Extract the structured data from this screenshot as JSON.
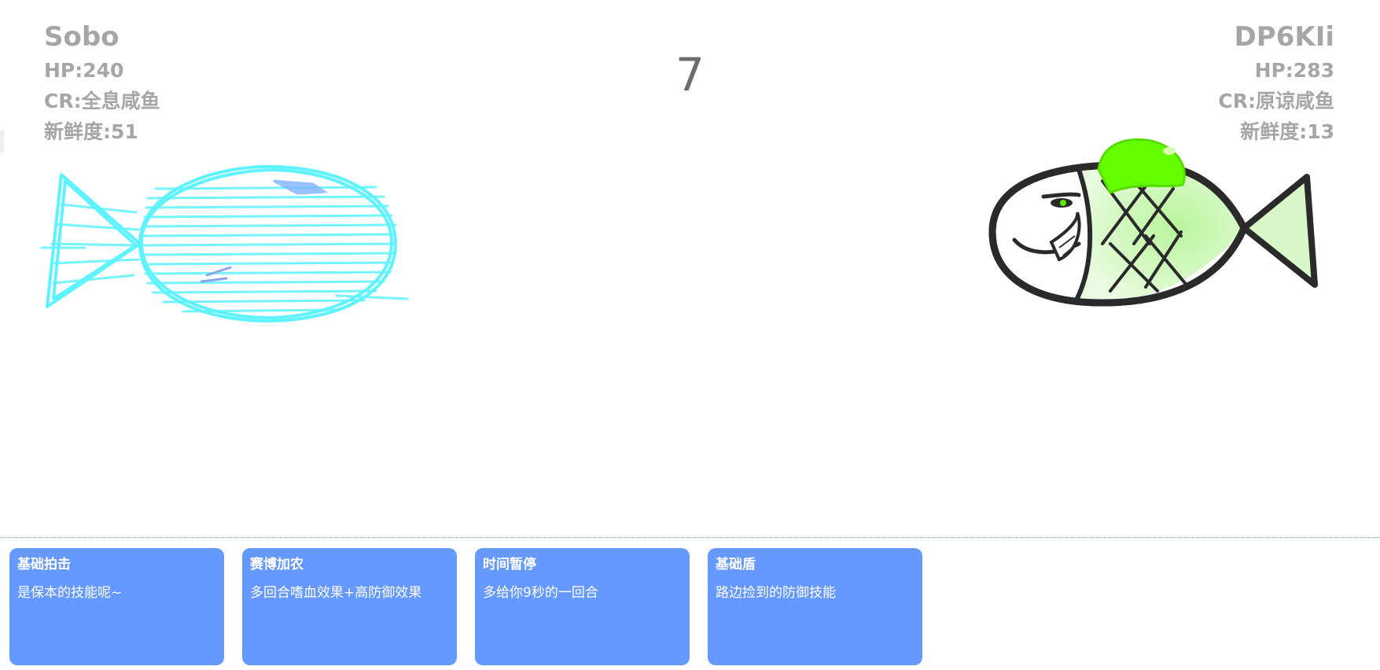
{
  "timer": "7",
  "player": {
    "name": "Sobo",
    "hp": "HP:240",
    "cr": "CR:全息咸鱼",
    "freshness": "新鲜度:51",
    "fish_color": "#5ef3ff"
  },
  "opponent": {
    "name": "DP6KIi",
    "hp": "HP:283",
    "cr": "CR:原谅咸鱼",
    "freshness": "新鲜度:13",
    "fish_color": "#66ff00"
  },
  "skills": [
    {
      "name": "基础拍击",
      "desc": "是保本的技能呢~"
    },
    {
      "name": "赛博加农",
      "desc": "多回合嗜血效果+高防御效果"
    },
    {
      "name": "时间暂停",
      "desc": "多给你9秒的一回合"
    },
    {
      "name": "基础盾",
      "desc": "路边捡到的防御技能"
    }
  ],
  "colors": {
    "skill_card": "#6699ff",
    "stat_text": "#a6a6a6",
    "timer_text": "#6d6d6d"
  }
}
